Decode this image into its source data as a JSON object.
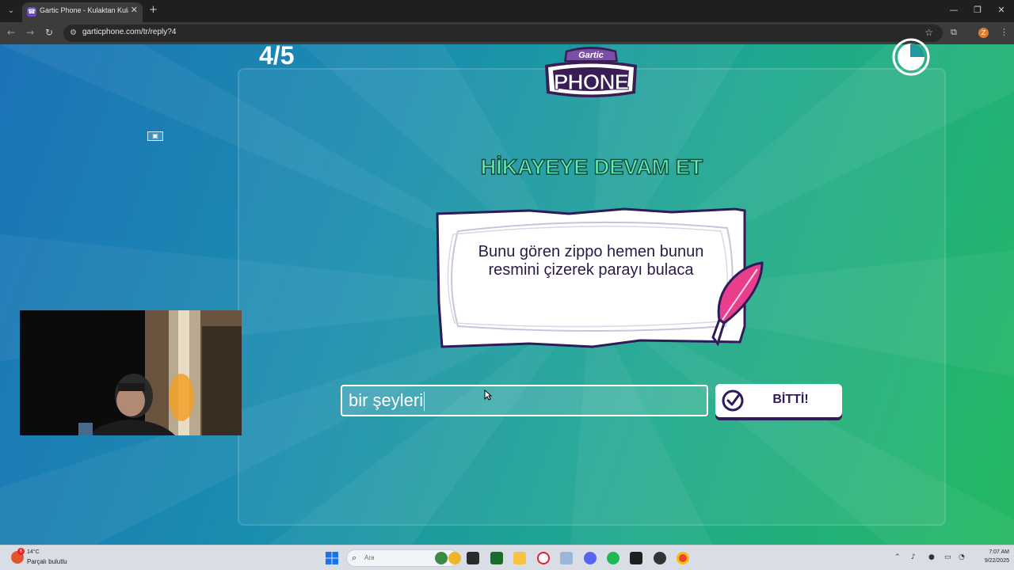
{
  "browser": {
    "tab_title": "Gartic Phone - Kulaktan Kulağa",
    "url": "garticphone.com/tr/reply?4",
    "profile_initial": "Z"
  },
  "game": {
    "round_counter": "4/5",
    "logo_top": "Gartic",
    "logo_main": "PHONE",
    "heading": "HİKAYEYE DEVAM ET",
    "prompt_text": "Bunu gören zippo hemen bunun resmini çizerek parayı bulaca",
    "answer_value": "bir şeyleri",
    "done_label": "BİTTİ!"
  },
  "colors": {
    "accent_green": "#5ef0b0",
    "dark_purple": "#2d1b5a",
    "quill_pink": "#e83e8c"
  },
  "taskbar": {
    "weather_temp": "14°C",
    "weather_badge": "6",
    "weather_desc": "Parçalı bulutlu",
    "search_placeholder": "Ara",
    "time": "7:07 AM",
    "date": "9/22/2025"
  },
  "icons": [
    "tab-search-icon",
    "gartic-favicon",
    "close-icon",
    "new-tab-icon",
    "minimize-icon",
    "maximize-icon",
    "window-close-icon",
    "back-icon",
    "forward-icon",
    "reload-icon",
    "site-info-icon",
    "star-icon",
    "extensions-icon",
    "menu-icon",
    "timer-icon",
    "quill-icon",
    "check-icon",
    "windows-start-icon",
    "search-icon"
  ]
}
